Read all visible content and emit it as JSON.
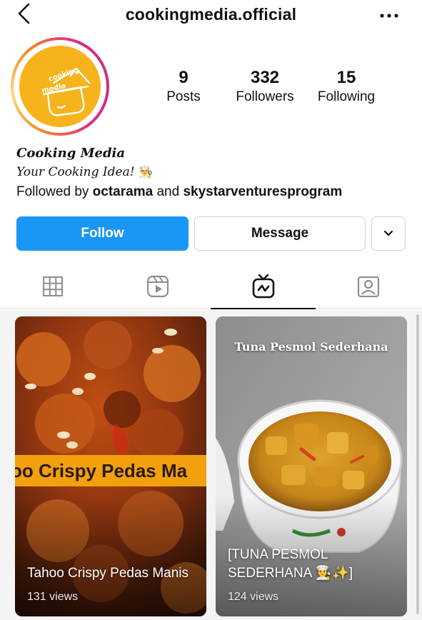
{
  "header": {
    "username": "cookingmedia.official",
    "back_icon": "chevron-left-icon",
    "more_icon": "more-horizontal-icon"
  },
  "profile": {
    "avatar_text": "cooking media",
    "stats": [
      {
        "value": "9",
        "label": "Posts"
      },
      {
        "value": "332",
        "label": "Followers"
      },
      {
        "value": "15",
        "label": "Following"
      }
    ],
    "display_name": "Cooking Media",
    "bio": "Your Cooking Idea!",
    "bio_emoji": "👨‍🍳",
    "followed_by_prefix": "Followed by ",
    "followed_by_user1": "octarama",
    "followed_by_and": " and ",
    "followed_by_user2": "skystarventuresprogram"
  },
  "actions": {
    "follow_label": "Follow",
    "message_label": "Message",
    "dropdown_icon": "chevron-down-icon"
  },
  "tabs": [
    {
      "icon": "grid-icon",
      "active": false
    },
    {
      "icon": "reels-icon",
      "active": false
    },
    {
      "icon": "igtv-icon",
      "active": true
    },
    {
      "icon": "tagged-icon",
      "active": false
    }
  ],
  "videos": [
    {
      "title": "Tahoo Crispy Pedas Manis",
      "views": "131 views",
      "thumb_banner": "oo Crispy Pedas Ma"
    },
    {
      "title": "[TUNA PESMOL SEDERHANA 👨‍🍳✨]",
      "views": "124 views",
      "thumb_caption": "Tuna Pesmol Sederhana"
    }
  ],
  "colors": {
    "follow_button": "#1a96f5",
    "avatar_bg": "#f7b31b",
    "banner": "#f2a00c"
  }
}
